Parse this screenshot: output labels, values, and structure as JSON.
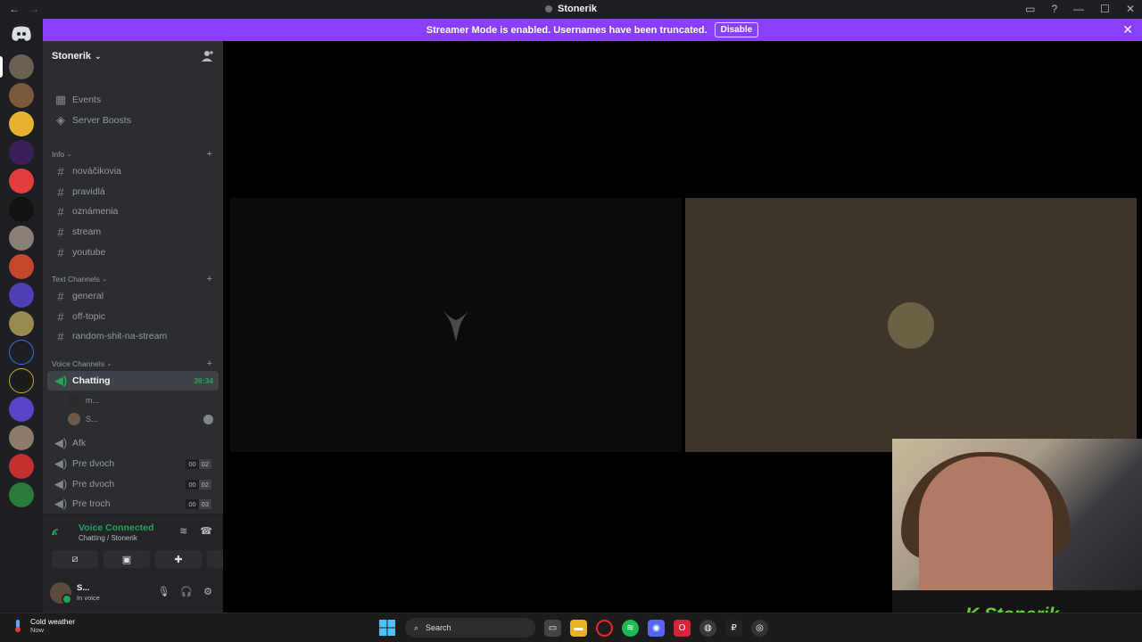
{
  "titlebar": {
    "title": "Stonerik",
    "back": "←",
    "forward": "→"
  },
  "banner": {
    "message": "Streamer Mode is enabled. Usernames have been truncated.",
    "disable_label": "Disable",
    "close": "✕",
    "color": "#8a3ffc"
  },
  "server": {
    "name": "Stonerik",
    "chevron": "⌄"
  },
  "sidebar": {
    "events": "Events",
    "boosts": "Server Boosts",
    "info_category": "Info",
    "info_channels": [
      "nováčikovia",
      "pravidlá",
      "oznámenia",
      "stream",
      "youtube"
    ],
    "text_category": "Text Channels",
    "text_channels": [
      "general",
      "off-topic",
      "random-shit-na-stream"
    ],
    "voice_category": "Voice Channels",
    "voice": {
      "active": {
        "name": "Chatting",
        "timer": "39:34"
      },
      "members": [
        "m...",
        "S..."
      ],
      "others": [
        {
          "name": "Afk"
        },
        {
          "name": "Pre dvoch",
          "count": "00",
          "limit": "02"
        },
        {
          "name": "Pre dvoch",
          "count": "00",
          "limit": "02"
        },
        {
          "name": "Pre troch",
          "count": "00",
          "limit": "03"
        }
      ]
    }
  },
  "voice_panel": {
    "status": "Voice Connected",
    "location": "Chatting / Stonerik",
    "accent": "#23a55a"
  },
  "user_panel": {
    "name": "S...",
    "status": "In voice"
  },
  "webcam": {
    "logo_text": "Stonerik",
    "logo_letter": "K"
  },
  "taskbar": {
    "weather_title": "Cold weather",
    "weather_sub": "Now",
    "search_label": "Search"
  },
  "icons": {
    "hash": "#",
    "speaker": "🔊",
    "plus": "+"
  }
}
